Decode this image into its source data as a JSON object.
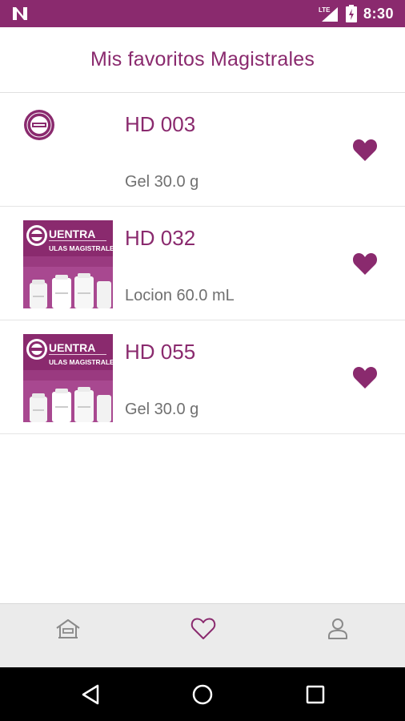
{
  "status_bar": {
    "time": "8:30",
    "network_label": "LTE",
    "icons": [
      "n-notification-icon",
      "signal-icon",
      "battery-charging-icon"
    ]
  },
  "header": {
    "title": "Mis favoritos Magistrales"
  },
  "favorites": [
    {
      "code": "HD 003",
      "detail": "Gel 30.0 g",
      "thumbnail": "brand-logo-icon",
      "favorited": true
    },
    {
      "code": "HD 032",
      "detail": "Locion 60.0 mL",
      "thumbnail": "product-photo",
      "favorited": true
    },
    {
      "code": "HD 055",
      "detail": "Gel 30.0 g",
      "thumbnail": "product-photo",
      "favorited": true
    }
  ],
  "product_photo": {
    "banner_line1": "UENTRA",
    "banner_line2": "ULAS MAGISTRALES"
  },
  "bottom_nav": {
    "items": [
      {
        "icon": "home-icon",
        "active": false
      },
      {
        "icon": "heart-outline-icon",
        "active": true
      },
      {
        "icon": "profile-icon",
        "active": false
      }
    ]
  },
  "colors": {
    "brand": "#8a2a6e",
    "text_secondary": "#707070",
    "nav_background": "#ebebeb",
    "icon_inactive": "#8a8a8a"
  }
}
